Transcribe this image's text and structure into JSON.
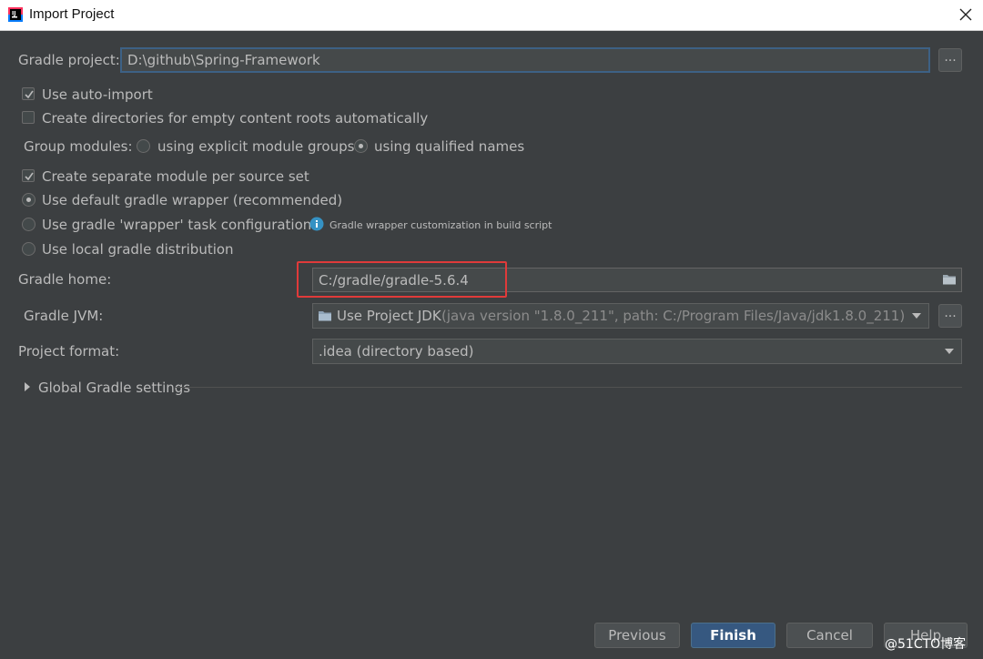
{
  "window": {
    "title": "Import Project"
  },
  "gradle_project": {
    "label": "Gradle project:",
    "value": "D:\\github\\Spring-Framework",
    "browse_label": "..."
  },
  "options": {
    "auto_import": "Use auto-import",
    "create_dirs": "Create directories for empty content roots automatically",
    "group_modules_label": "Group modules:",
    "explicit_groups": "using explicit module groups",
    "qualified_names": "using qualified names",
    "separate_module": "Create separate module per source set",
    "default_wrapper": "Use default gradle wrapper (recommended)",
    "wrapper_task": "Use gradle 'wrapper' task configuration",
    "wrapper_hint": "Gradle wrapper customization in build script",
    "local_distribution": "Use local gradle distribution"
  },
  "gradle_home": {
    "label": "Gradle home:",
    "value": "C:/gradle/gradle-5.6.4"
  },
  "gradle_jvm": {
    "label": "Gradle JVM:",
    "selected": "Use Project JDK",
    "detail": "(java version \"1.8.0_211\", path: C:/Program Files/Java/jdk1.8.0_211)",
    "browse_label": "..."
  },
  "project_format": {
    "label": "Project format:",
    "selected": ".idea (directory based)"
  },
  "global_settings": {
    "label": "Global Gradle settings"
  },
  "buttons": {
    "previous": "Previous",
    "finish": "Finish",
    "cancel": "Cancel",
    "help": "Help"
  },
  "watermark": "@51CTO博客",
  "colors": {
    "background": "#3c3f41",
    "accent": "#365880",
    "highlight_box": "#e03a3a"
  }
}
